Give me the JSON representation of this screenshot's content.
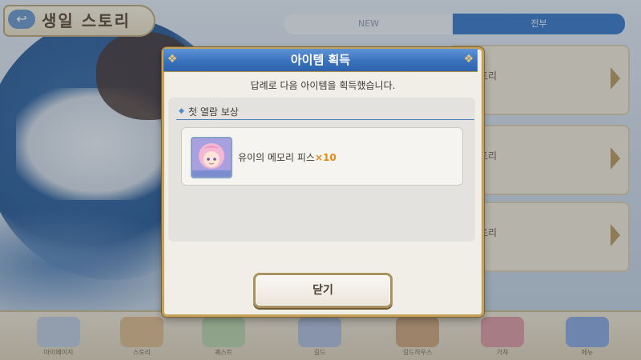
{
  "background": {
    "title": "생일 스토리",
    "back_icon": "↩",
    "tabs": [
      {
        "label": "NEW"
      },
      {
        "label": "전부"
      }
    ],
    "story_cards": [
      {
        "label": "토리"
      },
      {
        "label": "토리"
      },
      {
        "label": "토리"
      }
    ],
    "bottom_nav": [
      {
        "label": "마이페이지"
      },
      {
        "label": "스토리"
      },
      {
        "label": "퀘스트"
      },
      {
        "label": "길드"
      },
      {
        "label": "길드하우스"
      },
      {
        "label": "가챠"
      },
      {
        "label": "메뉴"
      }
    ]
  },
  "modal": {
    "title": "아이템 획득",
    "description": "답례로 다음 아이템을 획득했습니다.",
    "section_title": "첫 열람 보상",
    "item": {
      "name": "유이의 메모리 피스",
      "quantity": "×10",
      "icon": "memory-piece-icon"
    },
    "close_label": "닫기"
  },
  "colors": {
    "header_blue": "#3a72bd",
    "frame_gold": "#c6a15a",
    "quantity_orange": "#e18a16"
  }
}
